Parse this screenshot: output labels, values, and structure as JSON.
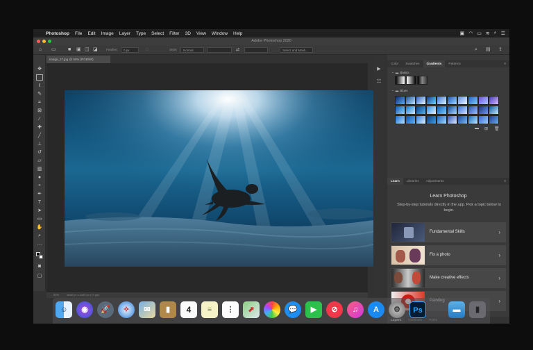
{
  "menubar": {
    "apple_glyph": "",
    "items": [
      {
        "label": "Photoshop",
        "bold": true
      },
      {
        "label": "File"
      },
      {
        "label": "Edit"
      },
      {
        "label": "Image"
      },
      {
        "label": "Layer"
      },
      {
        "label": "Type"
      },
      {
        "label": "Select"
      },
      {
        "label": "Filter"
      },
      {
        "label": "3D"
      },
      {
        "label": "View"
      },
      {
        "label": "Window"
      },
      {
        "label": "Help"
      }
    ]
  },
  "window": {
    "title": "Adobe Photoshop 2020"
  },
  "options_bar": {
    "feather_label": "Feather:",
    "feather_value": "0 px",
    "style_label": "Style:",
    "style_value": "Normal",
    "select_mask_label": "Select and Mask..."
  },
  "document": {
    "tab_label": "Image_27.jpg @ 50% (RGB/8#)",
    "zoom": "50%",
    "dimensions": "3840 px x 2160 px (72 ppi)"
  },
  "panels": {
    "top_tabs": [
      "Color",
      "Swatches",
      "Gradients",
      "Patterns"
    ],
    "top_active": "Gradients",
    "groups": [
      "Basics",
      "Blues"
    ],
    "learn_tabs": [
      "Learn",
      "Libraries",
      "Adjustments"
    ],
    "learn_active": "Learn",
    "learn_title": "Learn Photoshop",
    "learn_subtitle": "Step-by-step tutorials directly in the app. Pick a topic below to begin.",
    "tutorials": [
      {
        "label": "Fundamental Skills"
      },
      {
        "label": "Fix a photo"
      },
      {
        "label": "Make creative effects"
      },
      {
        "label": "Painting"
      }
    ],
    "bottom_tabs": [
      "Layers",
      "Channels",
      "Paths"
    ],
    "bottom_active": "Layers"
  },
  "dock": {
    "calendar_day": "4",
    "photoshop_label": "Ps"
  },
  "colors": {
    "accent": "#1473e6",
    "panel_bg": "#3a3a3a",
    "canvas_bg": "#282828"
  }
}
